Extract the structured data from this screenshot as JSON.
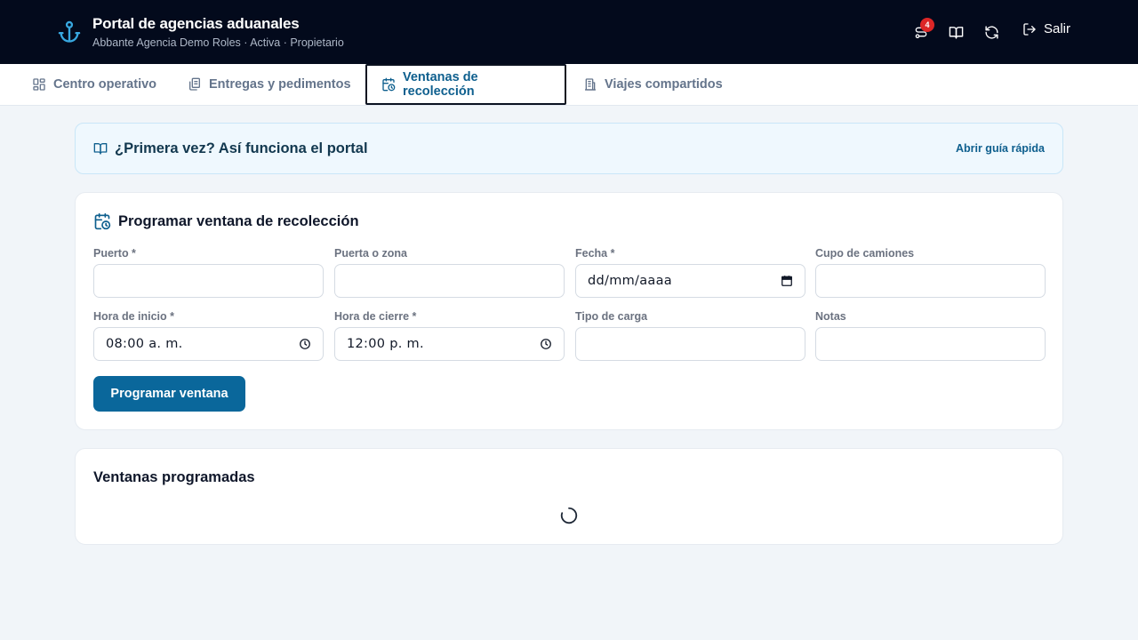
{
  "header": {
    "title": "Portal de agencias aduanales",
    "subtitle": "Abbante Agencia Demo Roles · Activa · Propietario",
    "notifications_count": "4",
    "logout_label": "Salir",
    "brand_color": "#38a8e0",
    "bg_color": "#030a1c"
  },
  "tabs": [
    {
      "label": "Centro operativo",
      "icon": "dashboard-icon",
      "active": false
    },
    {
      "label": "Entregas y pedimentos",
      "icon": "documents-icon",
      "active": false
    },
    {
      "label": "Ventanas de recolección",
      "icon": "calendar-clock-icon",
      "active": true
    },
    {
      "label": "Viajes compartidos",
      "icon": "building-icon",
      "active": false
    }
  ],
  "guide": {
    "title": "¿Primera vez? Así funciona el portal",
    "link": "Abrir guía rápida"
  },
  "form": {
    "title": "Programar ventana de recolección",
    "fields": {
      "puerto": {
        "label": "Puerto *",
        "value": ""
      },
      "puerta": {
        "label": "Puerta o zona",
        "value": ""
      },
      "fecha": {
        "label": "Fecha *",
        "value": "dd/mm/aaaa"
      },
      "cupo": {
        "label": "Cupo de camiones",
        "value": ""
      },
      "hora_inicio": {
        "label": "Hora de inicio *",
        "value": "08:00 a. m."
      },
      "hora_cierre": {
        "label": "Hora de cierre *",
        "value": "12:00 p. m."
      },
      "tipo_carga": {
        "label": "Tipo de carga",
        "value": ""
      },
      "notas": {
        "label": "Notas",
        "value": ""
      }
    },
    "submit_label": "Programar ventana",
    "accent_color": "#0a679b"
  },
  "list": {
    "title": "Ventanas programadas",
    "loading": true
  }
}
